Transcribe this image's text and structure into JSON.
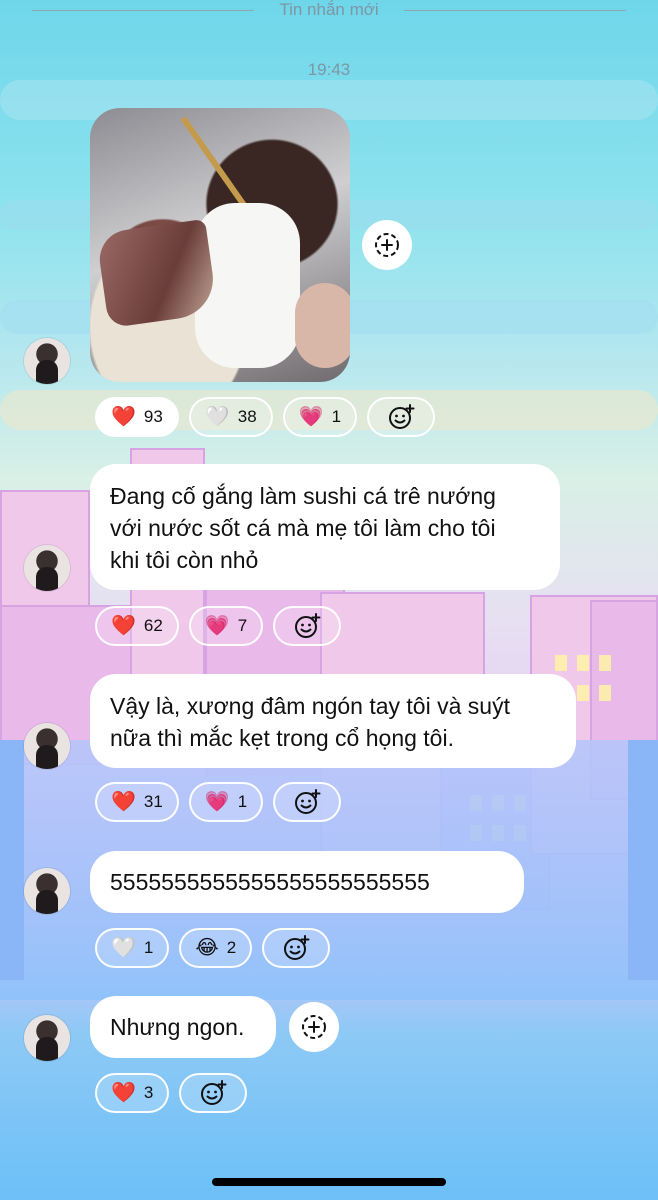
{
  "header": {
    "title": "Tin nhắn mới"
  },
  "timestamp": "19:43",
  "messages": [
    {
      "type": "photo",
      "reactions": [
        {
          "emoji": "❤️",
          "count": "93",
          "active": true
        },
        {
          "emoji": "🤍",
          "count": "38"
        },
        {
          "emoji": "💗",
          "count": "1"
        }
      ]
    },
    {
      "type": "text",
      "lines": [
        "Đang cố gắng làm sushi cá trê nướng",
        "với nước sốt cá mà mẹ tôi làm cho tôi",
        "khi tôi còn nhỏ"
      ],
      "reactions": [
        {
          "emoji": "❤️",
          "count": "62"
        },
        {
          "emoji": "💗",
          "count": "7"
        }
      ]
    },
    {
      "type": "text",
      "lines": [
        "Vậy là, xương đâm ngón tay tôi và suýt",
        "nữa thì mắc kẹt trong cổ họng tôi."
      ],
      "reactions": [
        {
          "emoji": "❤️",
          "count": "31"
        },
        {
          "emoji": "💗",
          "count": "1"
        }
      ]
    },
    {
      "type": "text",
      "lines": [
        "5555555555555555555555555"
      ],
      "reactions": [
        {
          "emoji": "🤍",
          "count": "1"
        },
        {
          "emoji": "😂",
          "count": "2"
        }
      ]
    },
    {
      "type": "text",
      "lines": [
        "Nhưng ngon."
      ],
      "reactions": [
        {
          "emoji": "❤️",
          "count": "3"
        }
      ]
    }
  ]
}
